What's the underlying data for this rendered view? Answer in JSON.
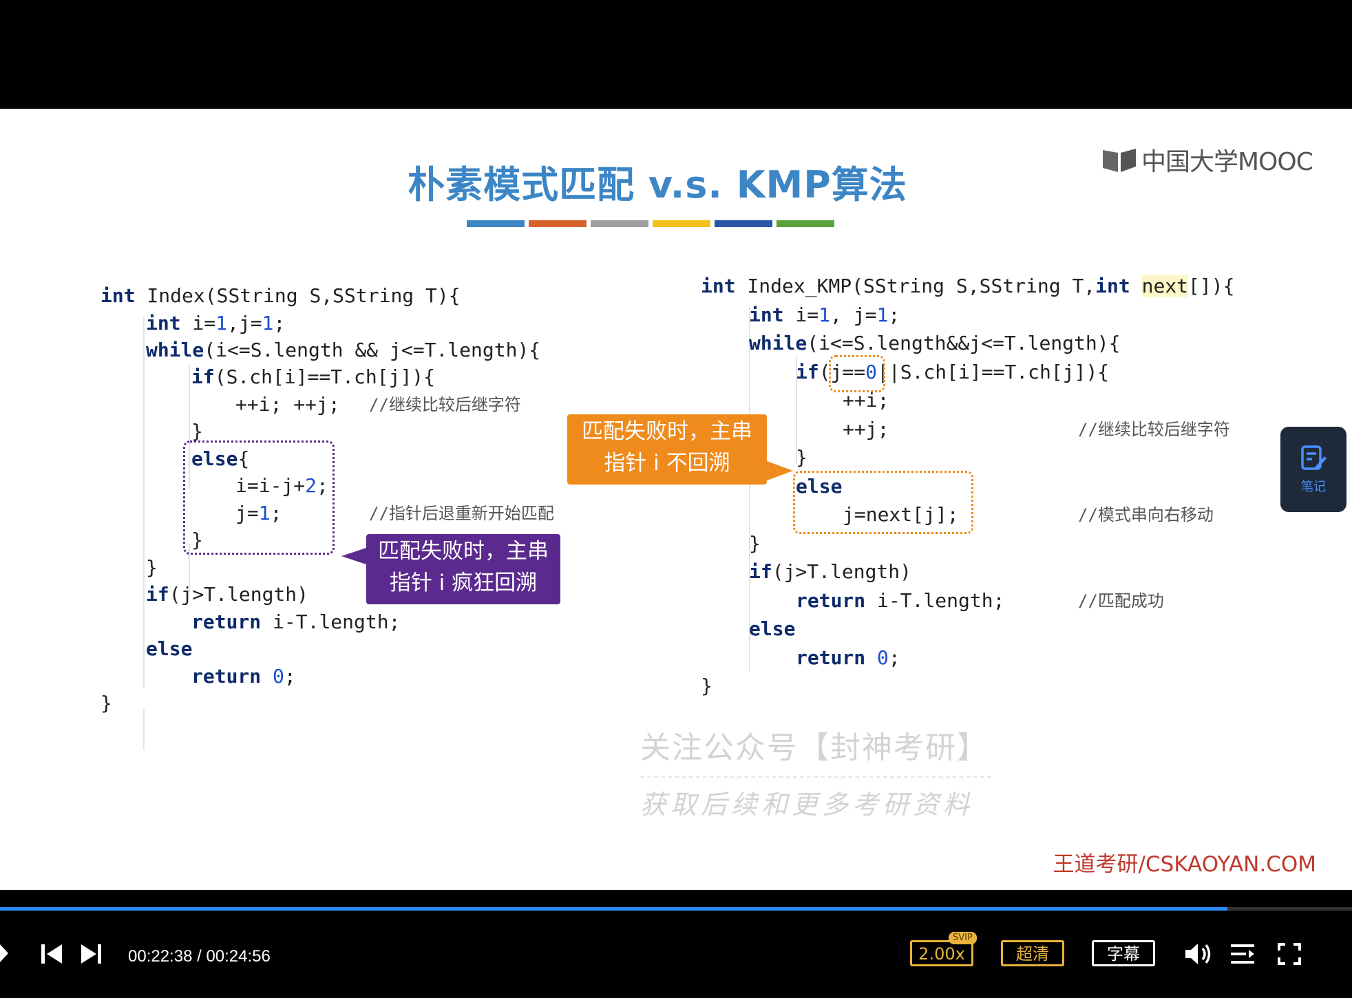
{
  "slide": {
    "title": "朴素模式匹配 v.s. KMP算法",
    "logo_text": "中国大学MOOC",
    "color_bar": [
      "#3d86c6",
      "#d9622b",
      "#a0a0a0",
      "#f2c21b",
      "#2a56a8",
      "#5aa33c"
    ],
    "brand": "王道考研/CSKAOYAN.COM"
  },
  "left_code": {
    "l1": {
      "kw": "int",
      "rest": " Index(SString S,SString T){"
    },
    "l2": {
      "kw": "int",
      "rest": " i=",
      "n1": "1",
      "rest2": ",j=",
      "n2": "1",
      "rest3": ";"
    },
    "l3": {
      "kw": "while",
      "rest": "(i<=S.length && j<=T.length){"
    },
    "l4": {
      "kw": "if",
      "rest": "(S.ch[i]==T.ch[j]){"
    },
    "l5": {
      "code": "++i; ++j;",
      "comment": "//继续比较后继字符"
    },
    "l6": "}",
    "l7": {
      "kw": "else",
      "rest": "{"
    },
    "l8": {
      "rest": "i=i-j+",
      "n1": "2",
      "rest2": ";"
    },
    "l9": {
      "rest": "j=",
      "n1": "1",
      "rest2": ";",
      "comment": "//指针后退重新开始匹配"
    },
    "l10": "}",
    "l11": "}",
    "l12": {
      "kw": "if",
      "rest": "(j>T.length)"
    },
    "l13": {
      "kw": "return",
      "rest": " i-T.length;"
    },
    "l14": {
      "kw": "else"
    },
    "l15": {
      "kw": "return",
      "n1": "0",
      "rest2": ";"
    },
    "l16": "}"
  },
  "right_code": {
    "r1": {
      "kw": "int",
      "rest": " Index_KMP(SString S,SString T,",
      "kw2": "int",
      "hl": "next",
      "rest2": "[]){"
    },
    "r2": {
      "kw": "int",
      "rest": " i=",
      "n1": "1",
      "rest2": ", j=",
      "n2": "1",
      "rest3": ";"
    },
    "r3": {
      "kw": "while",
      "rest": "(i<=S.length&&j<=T.length){"
    },
    "r4": {
      "kw": "if",
      "rest": "(j==",
      "n1": "0",
      "rest2": "||S.ch[i]==T.ch[j]){"
    },
    "r5": "++i;",
    "r6": {
      "code": "++j;",
      "comment": "//继续比较后继字符"
    },
    "r7": "}",
    "r8": {
      "kw": "else"
    },
    "r9": {
      "code": "j=next[j];",
      "comment": "//模式串向右移动"
    },
    "r10": "}",
    "r11": {
      "kw": "if",
      "rest": "(j>T.length)"
    },
    "r12": {
      "kw": "return",
      "rest": " i-T.length;",
      "comment": "//匹配成功"
    },
    "r13": {
      "kw": "else"
    },
    "r14": {
      "kw": "return",
      "n1": "0",
      "rest2": ";"
    },
    "r15": "}"
  },
  "callouts": {
    "orange_line1": "匹配失败时，主串",
    "orange_line2": "指针 i 不回溯",
    "purple_line1": "匹配失败时，主串",
    "purple_line2": "指针 i 疯狂回溯",
    "orange_color": "#ef8a1c",
    "purple_color": "#5b2a8e"
  },
  "watermark": {
    "line1": "关注公众号【封神考研】",
    "line2": "获取后续和更多考研资料"
  },
  "note_button": {
    "label": "笔记",
    "icon": "note-edit-icon"
  },
  "player": {
    "current_time": "00:22:38",
    "separator": " / ",
    "total_time": "00:24:56",
    "progress": 0.908,
    "speed": "2.00x",
    "speed_badge": "SVIP",
    "quality": "超清",
    "subtitle": "字幕",
    "accent": "#2f8cf6",
    "gold": "#e8b43c"
  }
}
